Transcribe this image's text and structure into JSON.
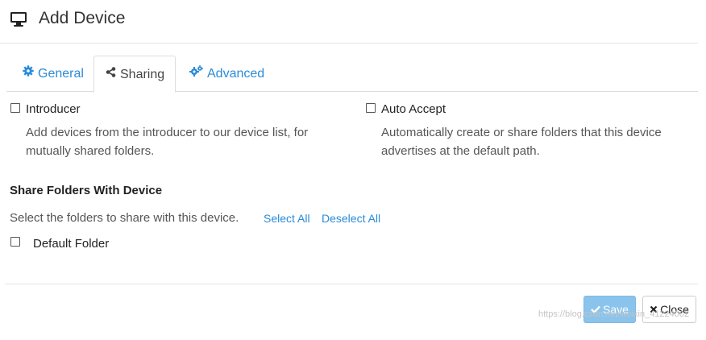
{
  "header": {
    "title": "Add Device",
    "icon": "monitor-icon"
  },
  "tabs": [
    {
      "label": "General",
      "icon": "gear-icon",
      "active": false
    },
    {
      "label": "Sharing",
      "icon": "share-icon",
      "active": true
    },
    {
      "label": "Advanced",
      "icon": "gears-icon",
      "active": false
    }
  ],
  "options": {
    "introducer": {
      "label": "Introducer",
      "checked": false,
      "help": "Add devices from the introducer to our device list, for mutually shared folders."
    },
    "auto_accept": {
      "label": "Auto Accept",
      "checked": false,
      "help": "Automatically create or share folders that this device advertises at the default path."
    }
  },
  "share": {
    "title": "Share Folders With Device",
    "help": "Select the folders to share with this device.",
    "select_all": "Select All",
    "deselect_all": "Deselect All",
    "folders": [
      {
        "label": "Default Folder",
        "checked": false
      }
    ]
  },
  "footer": {
    "save_label": "Save",
    "close_label": "Close",
    "watermark": "https://blog.csdn.net/weixin_41224002"
  },
  "colors": {
    "link": "#2a8bd8",
    "save_bg": "#8ac4ec"
  }
}
